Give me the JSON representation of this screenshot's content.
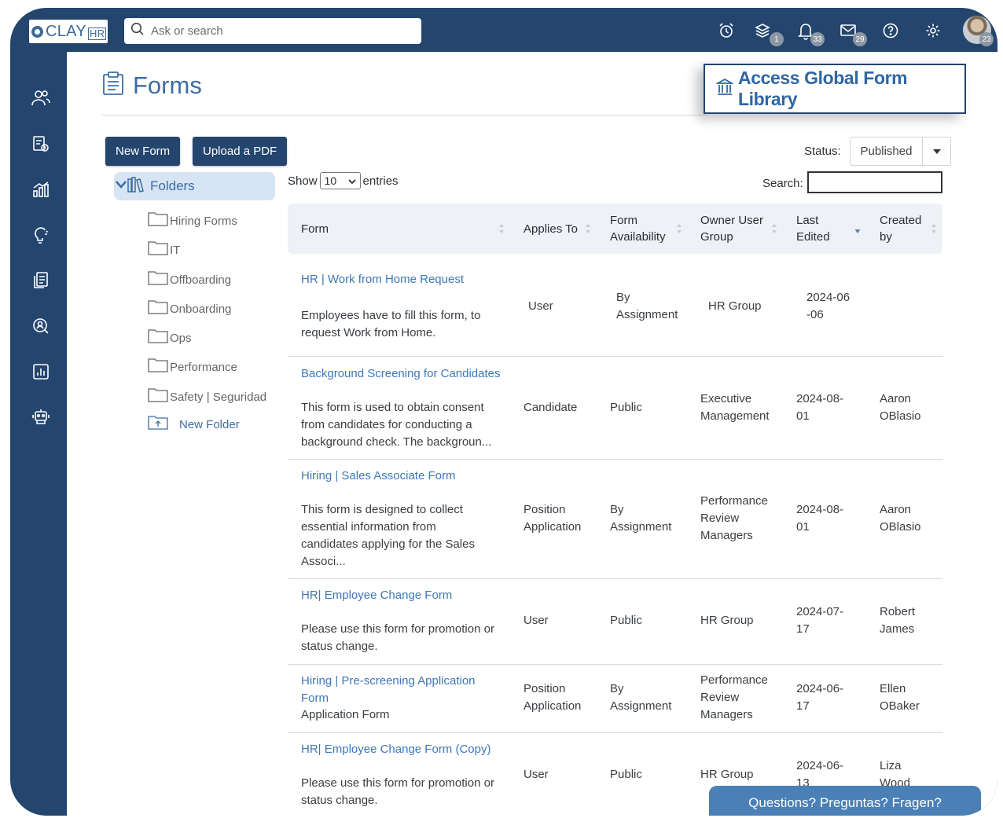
{
  "app": {
    "logo_text": "CLAY",
    "logo_suffix": "HR",
    "search_placeholder": "Ask or search",
    "badges": {
      "layers": "1",
      "notifications": "33",
      "messages": "29",
      "avatar": "23"
    }
  },
  "page": {
    "title": "Forms",
    "global_library_label": "Access Global Form Library",
    "new_form_label": "New Form",
    "upload_pdf_label": "Upload a PDF",
    "status_label": "Status:",
    "status_value": "Published"
  },
  "folders": {
    "header": "Folders",
    "items": [
      "Hiring Forms",
      "IT",
      "Offboarding",
      "Onboarding",
      "Ops",
      "Performance",
      "Safety | Seguridad"
    ],
    "new_folder_label": "New Folder"
  },
  "table_controls": {
    "show_label": "Show",
    "entries_value": "10",
    "entries_label": "entries",
    "search_label": "Search:"
  },
  "table": {
    "columns": [
      "Form",
      "Applies To",
      "Form Availability",
      "Owner User Group",
      "Last Edited",
      "Created by"
    ],
    "rows": [
      {
        "title": "HR | Work from Home Request",
        "description": "Employees have to fill this form, to request Work from Home.",
        "applies_to": "User",
        "availability": "By Assignment",
        "owner_group": "HR Group",
        "last_edited": "2024-06-06",
        "created_by": ""
      },
      {
        "title": "Background Screening for Candidates",
        "description": "This form is used to obtain consent from candidates for conducting a background check. The backgroun...",
        "applies_to": "Candidate",
        "availability": "Public",
        "owner_group": "Executive Management",
        "last_edited": "2024-08-01",
        "created_by": "Aaron OBlasio"
      },
      {
        "title": "Hiring | Sales Associate Form",
        "description": "This form is designed to collect essential information from candidates applying for the Sales Associ...",
        "applies_to": "Position Application",
        "availability": "By Assignment",
        "owner_group": "Performance Review Managers",
        "last_edited": "2024-08-01",
        "created_by": "Aaron OBlasio"
      },
      {
        "title": "HR| Employee Change Form",
        "description": "Please use this form for promotion or status change.",
        "applies_to": "User",
        "availability": "Public",
        "owner_group": "HR Group",
        "last_edited": "2024-07-17",
        "created_by": "Robert James"
      },
      {
        "title": "Hiring | Pre-screening Application Form",
        "description": "Application Form",
        "applies_to": "Position Application",
        "availability": "By Assignment",
        "owner_group": "Performance Review Managers",
        "last_edited": "2024-06-17",
        "created_by": "Ellen OBaker"
      },
      {
        "title": "HR| Employee Change Form (Copy)",
        "description": "Please use this form for promotion or status change.",
        "applies_to": "User",
        "availability": "Public",
        "owner_group": "HR Group",
        "last_edited": "2024-06-13",
        "created_by": "Liza Wood"
      }
    ]
  },
  "chat": {
    "label": "Questions? Preguntas? Fragen?"
  },
  "colors": {
    "navy": "#24456e",
    "link": "#3d78b8",
    "folder_highlight": "#d6e4f3"
  },
  "icons": [
    "alarm-icon",
    "layers-icon",
    "bell-icon",
    "mail-icon",
    "help-icon",
    "gear-icon",
    "people-icon",
    "clipboard-icon",
    "chart-icon",
    "bulb-icon",
    "document-icon",
    "search-person-icon",
    "report-icon",
    "robot-icon",
    "folder-icon",
    "library-icon"
  ]
}
